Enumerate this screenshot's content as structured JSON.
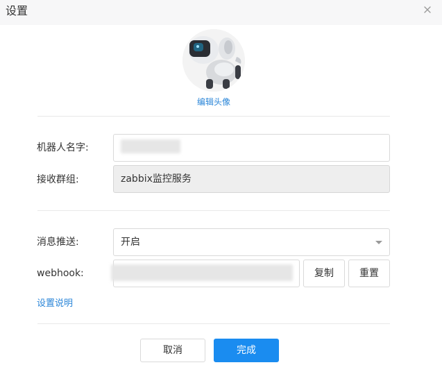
{
  "dialog": {
    "title": "设置"
  },
  "avatar": {
    "edit_label": "编辑头像"
  },
  "form": {
    "robot_name": {
      "label": "机器人名字:",
      "value": ""
    },
    "receive_group": {
      "label": "接收群组:",
      "value": "zabbix监控服务"
    },
    "push": {
      "label": "消息推送:",
      "value": "开启"
    },
    "webhook": {
      "label": "webhook:",
      "value": "",
      "copy_label": "复制",
      "reset_label": "重置"
    },
    "help_link": "设置说明"
  },
  "footer": {
    "cancel_label": "取消",
    "confirm_label": "完成"
  },
  "colors": {
    "accent": "#1a8cf0",
    "link": "#2b86d8",
    "title_bar": "#f7f7f8"
  },
  "icons": {
    "close": "close-icon",
    "dropdown": "chevron-down-icon"
  }
}
